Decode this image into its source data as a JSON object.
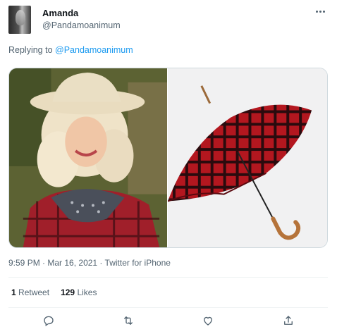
{
  "user": {
    "name": "Amanda",
    "handle": "@Pandamoanimum"
  },
  "reply": {
    "prefix": "Replying to ",
    "to": "@Pandamoanimum"
  },
  "media": {
    "images": [
      {
        "alt": "woman in cowboy hat and red plaid shirt"
      },
      {
        "alt": "red plaid umbrella with wooden handle"
      }
    ]
  },
  "meta": {
    "time": "9:59 PM",
    "date": "Mar 16, 2021",
    "source": "Twitter for iPhone",
    "dot": " · "
  },
  "stats": {
    "retweets_count": "1",
    "retweets_label": "Retweet",
    "likes_count": "129",
    "likes_label": "Likes"
  },
  "icons": {
    "more": "more-icon",
    "reply": "reply-icon",
    "retweet": "retweet-icon",
    "like": "heart-icon",
    "share": "share-icon"
  },
  "colors": {
    "link": "#1d9bf0",
    "secondary_text": "#536471",
    "primary_text": "#0f1419"
  }
}
